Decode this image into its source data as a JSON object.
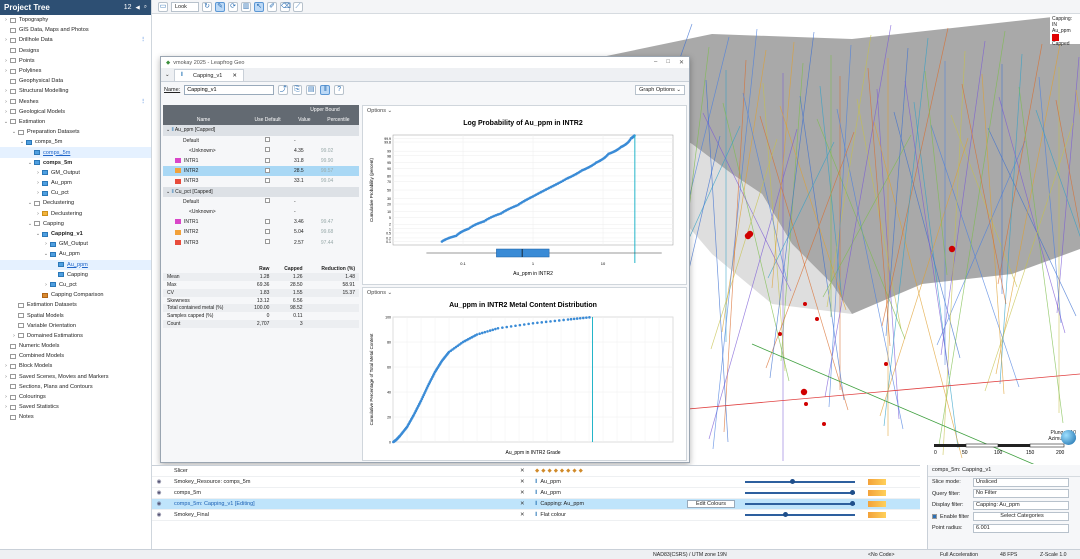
{
  "project_tree": {
    "title": "Project Tree",
    "count": "12",
    "items": [
      {
        "label": "Topography",
        "depth": 0,
        "arrow": "›"
      },
      {
        "label": "GIS Data, Maps and Photos",
        "depth": 0,
        "arrow": ""
      },
      {
        "label": "Drillhole Data",
        "depth": 0,
        "arrow": "›",
        "dot": "⋮"
      },
      {
        "label": "Designs",
        "depth": 0,
        "arrow": ""
      },
      {
        "label": "Points",
        "depth": 0,
        "arrow": "›"
      },
      {
        "label": "Polylines",
        "depth": 0,
        "arrow": "›"
      },
      {
        "label": "Geophysical Data",
        "depth": 0,
        "arrow": ""
      },
      {
        "label": "Structural Modelling",
        "depth": 0,
        "arrow": "›"
      },
      {
        "label": "Meshes",
        "depth": 0,
        "arrow": "›",
        "dot": "⋮"
      },
      {
        "label": "Geological Models",
        "depth": 0,
        "arrow": "›"
      },
      {
        "label": "Estimation",
        "depth": 0,
        "arrow": "⌄"
      },
      {
        "label": "Preparation Datasets",
        "depth": 1,
        "arrow": "⌄"
      },
      {
        "label": "comps_5m",
        "depth": 2,
        "arrow": "⌄",
        "icon": "g"
      },
      {
        "label": "comps_5m",
        "depth": 3,
        "arrow": "",
        "icon": "g",
        "link": true
      },
      {
        "label": "comps_5m",
        "depth": 3,
        "arrow": "⌄",
        "icon": "g",
        "bold": true
      },
      {
        "label": "GM_Output",
        "depth": 4,
        "arrow": "›",
        "icon": "g"
      },
      {
        "label": "Au_ppm",
        "depth": 4,
        "arrow": "›",
        "icon": "g"
      },
      {
        "label": "Cu_pct",
        "depth": 4,
        "arrow": "›",
        "icon": "g"
      },
      {
        "label": "Declustering",
        "depth": 3,
        "arrow": "⌄"
      },
      {
        "label": "Declustering",
        "depth": 4,
        "arrow": "›",
        "icon": "o"
      },
      {
        "label": "Capping",
        "depth": 3,
        "arrow": "⌄"
      },
      {
        "label": "Capping_v1",
        "depth": 4,
        "arrow": "⌄",
        "icon": "g",
        "bold": true
      },
      {
        "label": "GM_Output",
        "depth": 5,
        "arrow": "›",
        "icon": "g"
      },
      {
        "label": "Au_ppm",
        "depth": 5,
        "arrow": "⌄",
        "icon": "g"
      },
      {
        "label": "Au_ppm",
        "depth": 6,
        "arrow": "",
        "icon": "g",
        "link": true
      },
      {
        "label": "Capping",
        "depth": 6,
        "arrow": "",
        "icon": "g"
      },
      {
        "label": "Cu_pct",
        "depth": 5,
        "arrow": "›",
        "icon": "g"
      },
      {
        "label": "Capping Comparison",
        "depth": 4,
        "arrow": "",
        "icon": "r"
      },
      {
        "label": "Estimation Datasets",
        "depth": 1,
        "arrow": ""
      },
      {
        "label": "Spatial Models",
        "depth": 1,
        "arrow": ""
      },
      {
        "label": "Variable Orientation",
        "depth": 1,
        "arrow": ""
      },
      {
        "label": "Domained Estimations",
        "depth": 1,
        "arrow": "›"
      },
      {
        "label": "Numeric Models",
        "depth": 0,
        "arrow": ""
      },
      {
        "label": "Combined Models",
        "depth": 0,
        "arrow": ""
      },
      {
        "label": "Block Models",
        "depth": 0,
        "arrow": "›"
      },
      {
        "label": "Saved Scenes, Movies and Markers",
        "depth": 0,
        "arrow": "›"
      },
      {
        "label": "Sections, Plans and Contours",
        "depth": 0,
        "arrow": ""
      },
      {
        "label": "Colourings",
        "depth": 0,
        "arrow": "›"
      },
      {
        "label": "Saved Statistics",
        "depth": 0,
        "arrow": "›"
      },
      {
        "label": "Notes",
        "depth": 0,
        "arrow": ""
      }
    ]
  },
  "toolbar": {
    "look": "Look"
  },
  "scene_legend": {
    "title1": "Capping: IN",
    "title2": "Au_ppm",
    "item": "Capped",
    "item_color": "#e00000"
  },
  "scene_orientation": {
    "plunge": "Plunge +10",
    "azimuth": "Azimuth 215"
  },
  "scalebar": {
    "labels": [
      "0",
      "50",
      "100",
      "150",
      "200"
    ]
  },
  "window": {
    "title": "vmokay 2025 - Leapfrog Geo",
    "tab": "Capping_v1",
    "name_label": "Name:",
    "name_value": "Capping_v1",
    "graph_options": "Graph Options",
    "table": {
      "upper_bound": "Upper Bound",
      "headers": [
        "Name",
        "Use Default",
        "Value",
        "Percentile"
      ],
      "groups": [
        {
          "label": "Au_ppm [Capped]",
          "rows": [
            {
              "name": "Default",
              "value": "-",
              "pct": "",
              "color": "",
              "ind": 0
            },
            {
              "name": "<Unknown>",
              "value": "4.35",
              "pct": "99.02",
              "color": "",
              "ind": 1
            },
            {
              "name": "INTR1",
              "value": "31.8",
              "pct": "99.90",
              "color": "#d946c8",
              "ind": 0
            },
            {
              "name": "INTR2",
              "value": "28.5",
              "pct": "99.57",
              "color": "#f2a13a",
              "ind": 0,
              "hl": true
            },
            {
              "name": "INTR3",
              "value": "33.1",
              "pct": "99.04",
              "color": "#e84c3c",
              "ind": 0
            }
          ]
        },
        {
          "label": "Cu_pct [Capped]",
          "rows": [
            {
              "name": "Default",
              "value": "-",
              "pct": "",
              "color": "",
              "ind": 0
            },
            {
              "name": "<Unknown>",
              "value": "-",
              "pct": "",
              "color": "",
              "ind": 1
            },
            {
              "name": "INTR1",
              "value": "3.46",
              "pct": "99.47",
              "color": "#d946c8",
              "ind": 0
            },
            {
              "name": "INTR2",
              "value": "5.04",
              "pct": "99.68",
              "color": "#f2a13a",
              "ind": 0
            },
            {
              "name": "INTR3",
              "value": "2.57",
              "pct": "97.44",
              "color": "#e84c3c",
              "ind": 0
            }
          ]
        }
      ]
    },
    "stats": {
      "headers": [
        "",
        "Raw",
        "Capped",
        "Reduction (%)"
      ],
      "rows": [
        [
          "Mean",
          "1.28",
          "1.26",
          "1.48"
        ],
        [
          "Max",
          "69.36",
          "28.50",
          "58.91"
        ],
        [
          "CV",
          "1.83",
          "1.55",
          "15.37"
        ],
        [
          "Skewness",
          "13.12",
          "6.56",
          ""
        ],
        [
          "Total contained metal (%)",
          "100.00",
          "98.52",
          ""
        ],
        [
          "Samples capped (%)",
          "0",
          "0.11",
          ""
        ],
        [
          "Count",
          "2,707",
          "3",
          ""
        ]
      ]
    },
    "options_label": "Options"
  },
  "chart_data": [
    {
      "type": "scatter",
      "title": "Log Probability of Au_ppm in INTR2",
      "xlabel": "Au_ppm in INTR2",
      "ylabel": "Cumulative Probability (percent)",
      "x_scale": "log",
      "x_ticks": [
        "0.1",
        "1",
        "10"
      ],
      "y_ticks": [
        "0.1",
        "0.2",
        "0.5",
        "1",
        "2",
        "5",
        "10",
        "20",
        "30",
        "50",
        "70",
        "80",
        "90",
        "95",
        "98",
        "99",
        "99.8",
        "99.9"
      ],
      "cap_value": 28.5,
      "x": [
        0.05,
        0.08,
        0.12,
        0.2,
        0.35,
        0.6,
        1,
        1.7,
        3,
        5,
        8,
        12,
        18,
        25,
        28.5
      ],
      "y": [
        0.1,
        0.3,
        1,
        3,
        8,
        18,
        35,
        55,
        75,
        88,
        95,
        98.5,
        99.5,
        99.9,
        99.95
      ],
      "boxplot": {
        "min": 0.03,
        "q1": 0.3,
        "median": 0.7,
        "q3": 1.7,
        "max": 69
      }
    },
    {
      "type": "scatter",
      "title": "Au_ppm in INTR2 Metal Content Distribution",
      "xlabel": "Au_ppm in INTR2 Grade",
      "ylabel": "Cumulative Percentage of Total Metal Content",
      "ylim": [
        0,
        100
      ],
      "y_ticks": [
        "0",
        "20",
        "40",
        "60",
        "80",
        "100"
      ],
      "cap_value": 28.5,
      "x": [
        0.05,
        0.5,
        1,
        2,
        3,
        4,
        5,
        6,
        7,
        8,
        10,
        12,
        15,
        20,
        25,
        28.5
      ],
      "y": [
        0,
        2,
        5,
        12,
        22,
        33,
        45,
        56,
        65,
        72,
        80,
        86,
        91,
        95,
        98,
        100
      ]
    }
  ],
  "bottom_rows": [
    {
      "name": "Slicer",
      "sel": "",
      "extra": ""
    },
    {
      "name": "Smokey_Resource: comps_5m",
      "sel": "Au_ppm",
      "extra": ""
    },
    {
      "name": "comps_5m",
      "sel": "Au_ppm",
      "extra": ""
    },
    {
      "name": "comps_5m: Capping_v1 [Editing]",
      "sel": "Capping: Au_ppm",
      "extra": "Edit Colours",
      "hl": true
    },
    {
      "name": "Smokey_Final",
      "sel": "Flat colour",
      "extra": ""
    }
  ],
  "prop_panel": {
    "title": "comps_5m: Capping_v1",
    "slice_mode_label": "Slice mode:",
    "slice_mode": "Unsliced",
    "query_label": "Query filter:",
    "query": "No Filter",
    "display_label": "Display filter:",
    "display": "Capping: Au_ppm",
    "enable_filter": "Enable filter",
    "categories": "Select Categories",
    "radius_label": "Point radius:",
    "radius": "6.001"
  },
  "status": {
    "crs": "NAD83(CSRS) / UTM zone 19N",
    "code": "<No Code>",
    "accel": "Full Acceleration",
    "fps": "48 FPS",
    "zscale": "Z-Scale 1.0"
  }
}
